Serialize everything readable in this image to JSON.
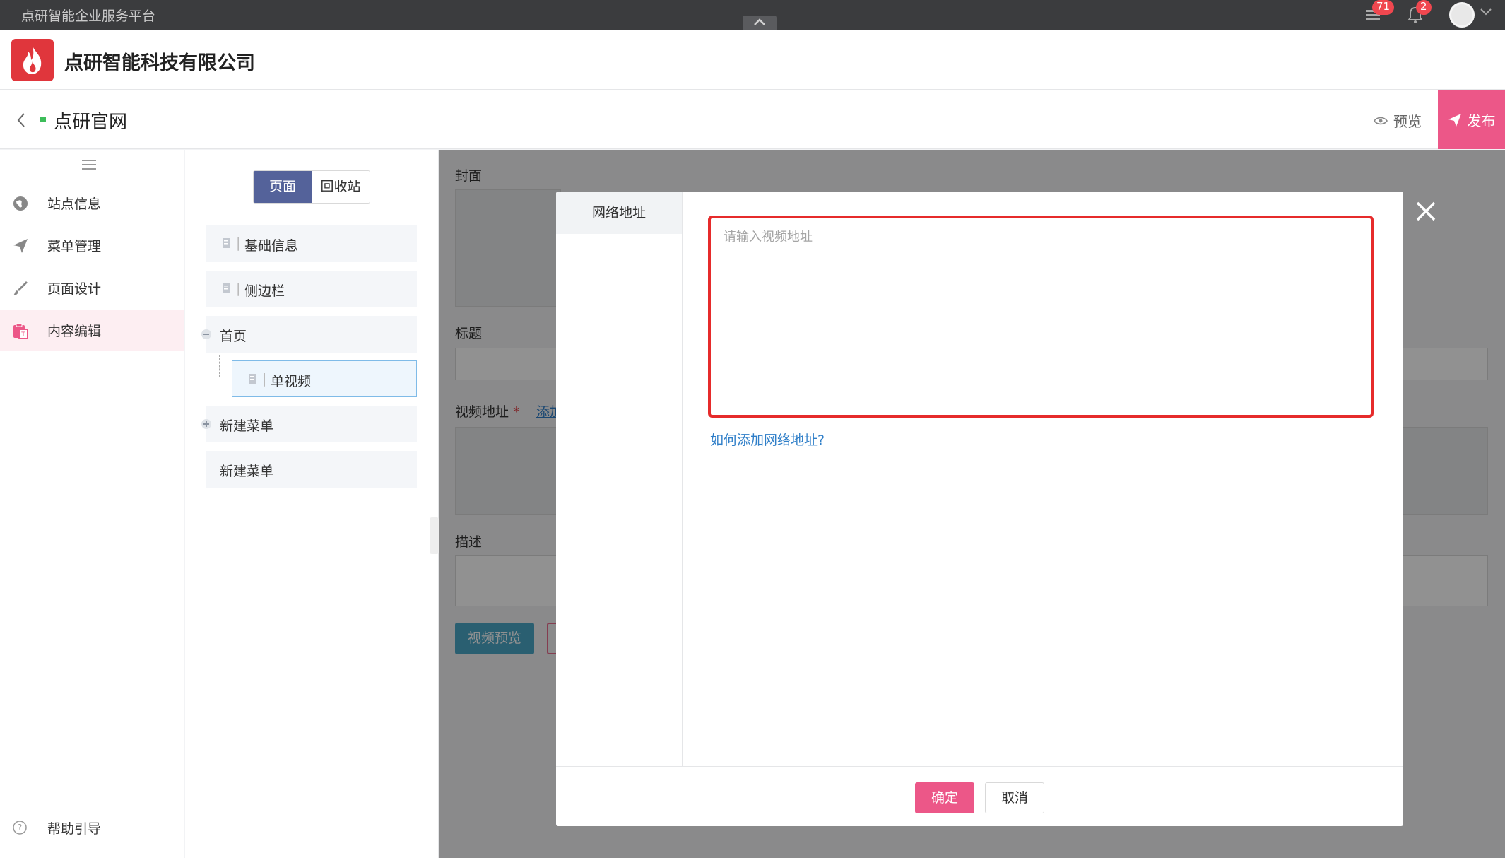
{
  "topbar": {
    "platform": "点研智能企业服务平台",
    "messages_badge": "71",
    "notifications_badge": "2"
  },
  "company": {
    "name": "点研智能科技有限公司"
  },
  "site": {
    "title": "点研官网",
    "preview_label": "预览",
    "publish_label": "发布"
  },
  "sidebar": {
    "items": [
      {
        "label": "站点信息",
        "icon": "globe-icon"
      },
      {
        "label": "菜单管理",
        "icon": "paper-plane-icon"
      },
      {
        "label": "页面设计",
        "icon": "brush-icon"
      },
      {
        "label": "内容编辑",
        "icon": "clipboard-icon"
      }
    ],
    "help_label": "帮助引导"
  },
  "tree": {
    "tabs": [
      "页面",
      "回收站"
    ],
    "items": [
      {
        "label": "基础信息"
      },
      {
        "label": "侧边栏"
      },
      {
        "label": "首页"
      },
      {
        "label": "单视频"
      },
      {
        "label": "新建菜单"
      },
      {
        "label": "新建菜单"
      }
    ]
  },
  "editor": {
    "cover_label": "封面",
    "title_label": "标题",
    "video_url_label": "视频地址",
    "required_mark": "*",
    "add_link_partial": "添加",
    "description_label": "描述",
    "preview_video_btn": "视频预览"
  },
  "modal": {
    "tab_label": "网络地址",
    "url_placeholder": "请输入视频地址",
    "help_link": "如何添加网络地址?",
    "ok_label": "确定",
    "cancel_label": "取消"
  },
  "colors": {
    "accent_pink": "#ec5788",
    "topbar_bg": "#3b3c3e",
    "segment_active": "#54629a",
    "highlight_red": "#e62b2b",
    "link_blue": "#2e7ec8"
  }
}
